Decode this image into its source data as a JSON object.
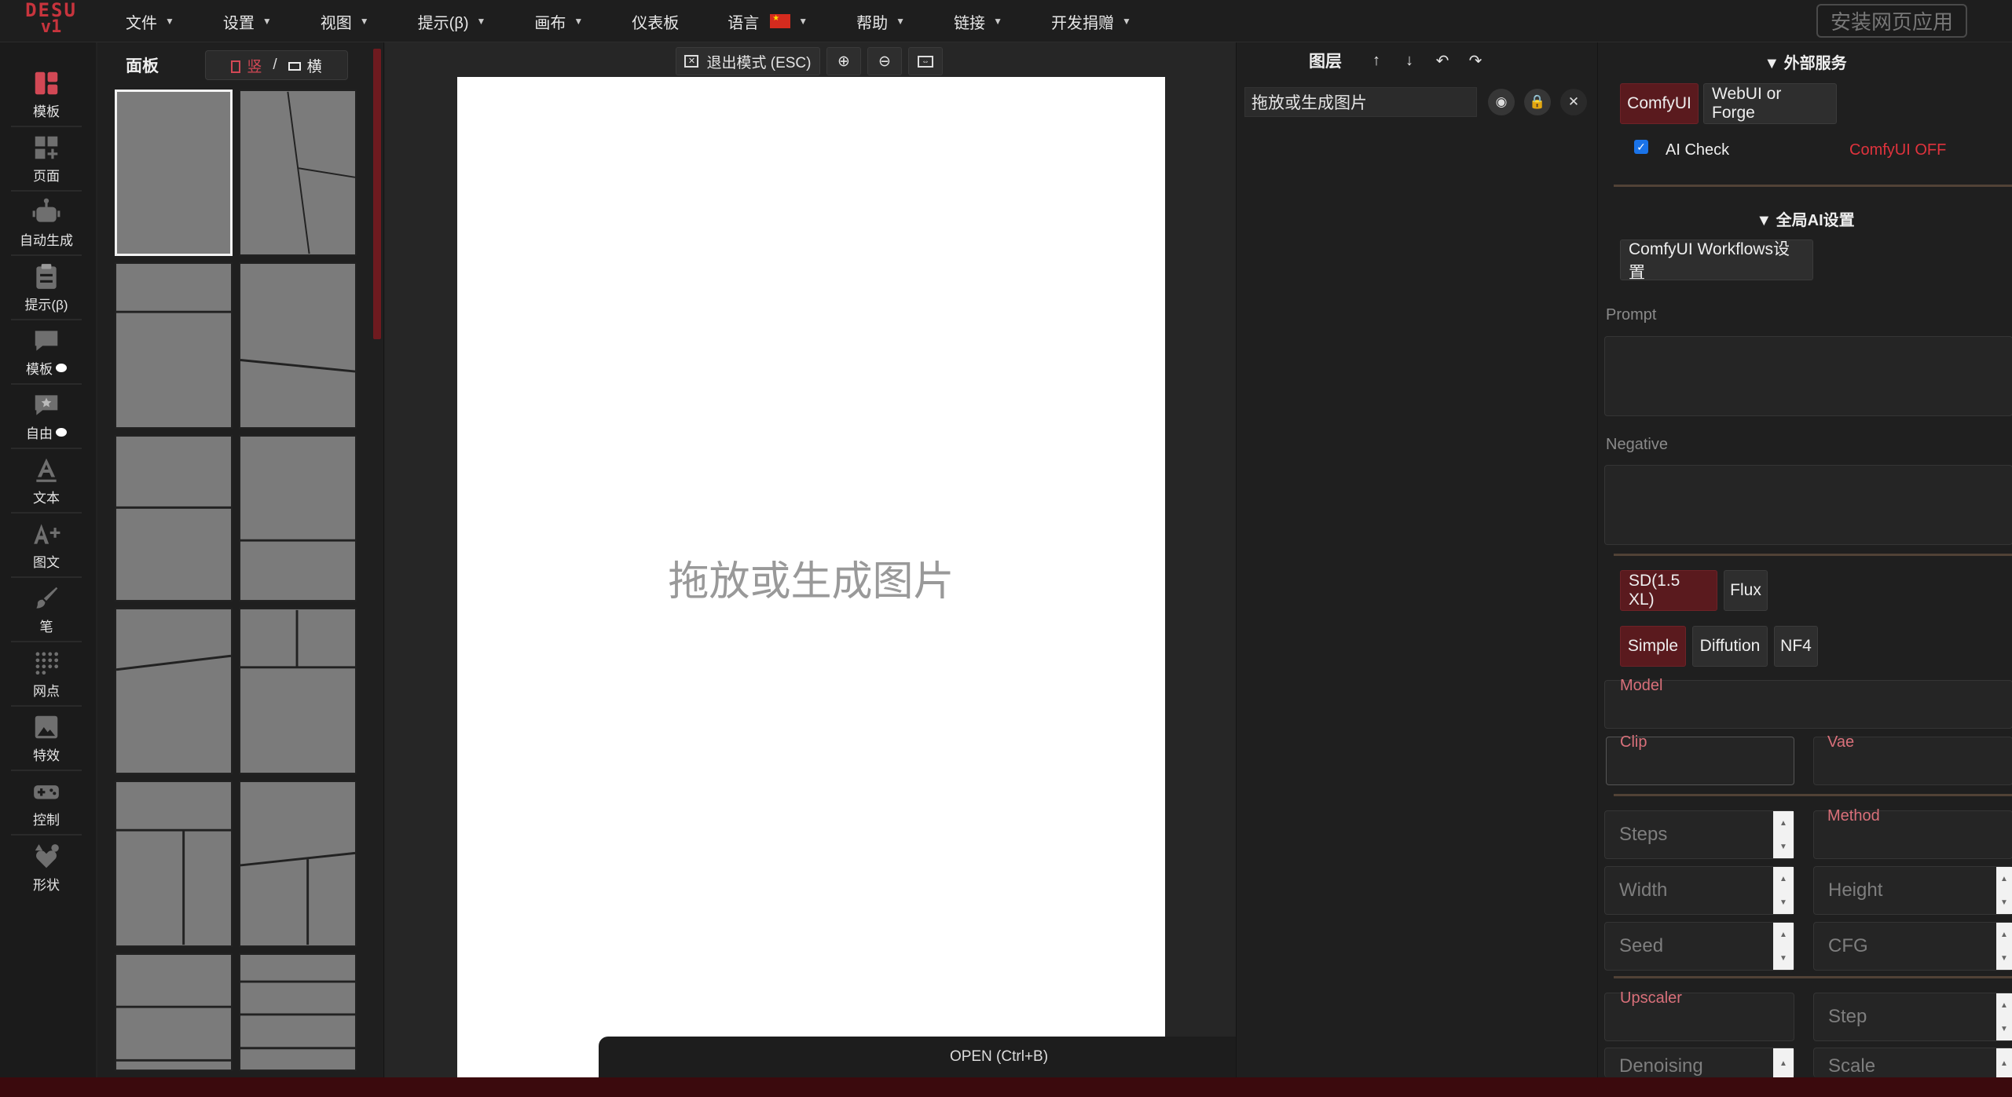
{
  "app": {
    "logo_line1": "DESU",
    "logo_line2": "v1",
    "install_label": "安装网页应用"
  },
  "menu": [
    {
      "label": "文件",
      "caret": true
    },
    {
      "label": "设置",
      "caret": true
    },
    {
      "label": "视图",
      "caret": true
    },
    {
      "label": "提示(β)",
      "caret": true
    },
    {
      "label": "画布",
      "caret": true
    },
    {
      "label": "仪表板",
      "caret": false
    },
    {
      "label": "语言",
      "caret": true,
      "flag": "cn-flag"
    },
    {
      "label": "帮助",
      "caret": true
    },
    {
      "label": "链接",
      "caret": true
    },
    {
      "label": "开发捐赠",
      "caret": true
    }
  ],
  "tools": [
    {
      "label": "模板",
      "icon": "template-icon",
      "active": true
    },
    {
      "label": "页面",
      "icon": "page-icon"
    },
    {
      "label": "自动生成",
      "icon": "robot-icon"
    },
    {
      "label": "提示(β)",
      "icon": "clipboard-icon"
    },
    {
      "label": "模板",
      "icon": "panel-icon",
      "dot": true
    },
    {
      "label": "自由",
      "icon": "free-icon",
      "dot": true
    },
    {
      "label": "文本",
      "icon": "text-icon"
    },
    {
      "label": "图文",
      "icon": "text-image-icon"
    },
    {
      "label": "笔",
      "icon": "brush-icon"
    },
    {
      "label": "网点",
      "icon": "screentone-icon"
    },
    {
      "label": "特效",
      "icon": "effect-icon"
    },
    {
      "label": "控制",
      "icon": "gamepad-icon"
    },
    {
      "label": "形状",
      "icon": "shapes-icon"
    }
  ],
  "panel": {
    "title": "面板",
    "vertical": "竖",
    "slash": "/",
    "horizontal": "横"
  },
  "canvas": {
    "exit_mode": "退出模式 (ESC)",
    "placeholder": "拖放或生成图片",
    "open_label": "OPEN (Ctrl+B)"
  },
  "layers": {
    "title": "图层",
    "item_name": "拖放或生成图片"
  },
  "ai": {
    "external_title": "▼ 外部服务",
    "comfyui": "ComfyUI",
    "webui": "WebUI or Forge",
    "ai_check": "AI Check",
    "comfy_status": "ComfyUI OFF",
    "global_title": "▼ 全局AI设置",
    "workflows": "ComfyUI Workflows设置",
    "prompt_label": "Prompt",
    "negative_label": "Negative",
    "sd": "SD(1.5 XL)",
    "flux": "Flux",
    "simple": "Simple",
    "diffution": "Diffution",
    "nf4": "NF4",
    "model": "Model",
    "clip": "Clip",
    "vae": "Vae",
    "steps": "Steps",
    "method": "Method",
    "width": "Width",
    "height": "Height",
    "seed": "Seed",
    "cfg": "CFG",
    "upscaler": "Upscaler",
    "step": "Step",
    "denoising": "Denoising",
    "scale": "Scale",
    "colors": {
      "accent": "#c8343d",
      "active_bg": "#5a1a1e",
      "status_off": "#e0333d"
    }
  }
}
